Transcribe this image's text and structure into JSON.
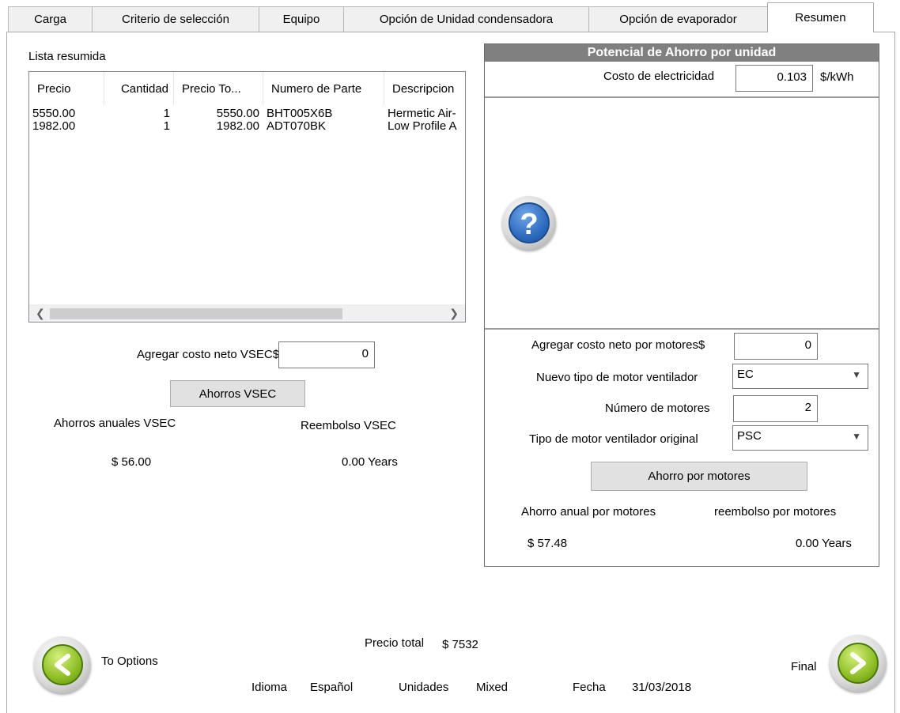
{
  "tabs": [
    {
      "label": "Carga"
    },
    {
      "label": "Criterio de selección"
    },
    {
      "label": "Equipo"
    },
    {
      "label": "Opción de Unidad condensadora"
    },
    {
      "label": "Opción de evaporador"
    },
    {
      "label": "Resumen",
      "active": true
    }
  ],
  "summary": {
    "label": "Lista resumida",
    "columns": [
      "Precio",
      "Cantidad",
      "Precio To...",
      "Numero de Parte",
      "Descripcion"
    ],
    "rows": [
      [
        "5550.00",
        "1",
        "5550.00",
        "BHT005X6B",
        "Hermetic Air-"
      ],
      [
        "1982.00",
        "1",
        "1982.00",
        "ADT070BK",
        "Low Profile A"
      ]
    ],
    "scroll_left_icon": "chevron-left-icon",
    "scroll_right_icon": "chevron-right-icon"
  },
  "vsec": {
    "net_cost_label": "Agregar costo neto VSEC$",
    "net_cost_value": "0",
    "button_label": "Ahorros VSEC",
    "annual_label": "Ahorros anuales VSEC",
    "payback_label": "Reembolso VSEC",
    "annual_value": "$ 56.00",
    "payback_value": "0.00 Years"
  },
  "savings": {
    "title": "Potencial de Ahorro por unidad",
    "electricity_label": "Costo de electricidad",
    "electricity_value": "0.103",
    "electricity_unit": "$/kWh",
    "help_icon": "help-question-icon",
    "motor_net_cost_label": "Agregar costo neto por motores$",
    "motor_net_cost_value": "0",
    "new_motor_type_label": "Nuevo tipo de motor ventilador",
    "new_motor_type_value": "EC",
    "motor_count_label": "Número de motores",
    "motor_count_value": "2",
    "orig_motor_type_label": "Tipo de motor ventilador original",
    "orig_motor_type_value": "PSC",
    "button_label": "Ahorro por motores",
    "annual_label": "Ahorro anual por motores",
    "payback_label": "reembolso por motores",
    "annual_value": "$ 57.48",
    "payback_value": "0.00 Years"
  },
  "footer": {
    "back_label": "To Options",
    "back_icon": "arrow-left-circle-icon",
    "total_label": "Precio total",
    "total_value": "$ 7532",
    "language_label": "Idioma",
    "language_value": "Español",
    "units_label": "Unidades",
    "units_value": "Mixed",
    "date_label": "Fecha",
    "date_value": "31/03/2018",
    "next_label": "Final",
    "next_icon": "arrow-right-circle-icon"
  },
  "colors": {
    "group_header_bg": "#808080",
    "nav_green": "#8dbe26",
    "help_blue": "#2f6cc0"
  }
}
